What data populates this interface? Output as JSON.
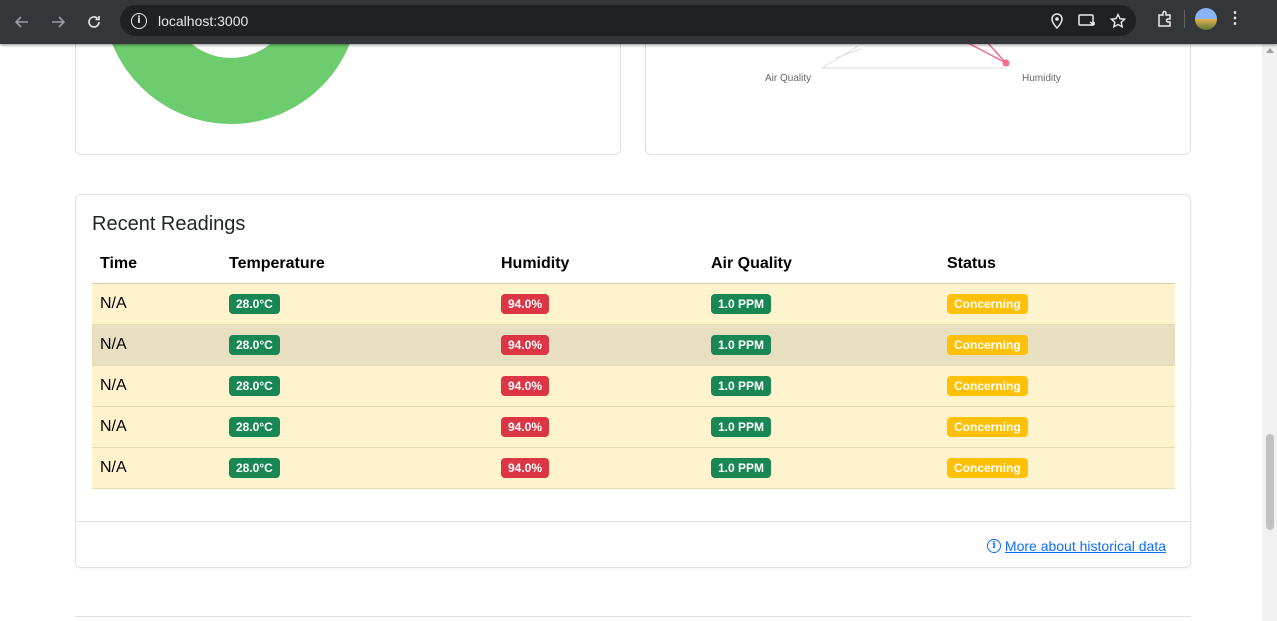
{
  "browser": {
    "url": "localhost:3000"
  },
  "radar": {
    "labels": [
      "Air Quality",
      "Humidity"
    ]
  },
  "readings": {
    "title": "Recent Readings",
    "columns": [
      "Time",
      "Temperature",
      "Humidity",
      "Air Quality",
      "Status"
    ],
    "rows": [
      {
        "time": "N/A",
        "temperature": "28.0°C",
        "humidity": "94.0%",
        "air_quality": "1.0 PPM",
        "status": "Concerning"
      },
      {
        "time": "N/A",
        "temperature": "28.0°C",
        "humidity": "94.0%",
        "air_quality": "1.0 PPM",
        "status": "Concerning"
      },
      {
        "time": "N/A",
        "temperature": "28.0°C",
        "humidity": "94.0%",
        "air_quality": "1.0 PPM",
        "status": "Concerning"
      },
      {
        "time": "N/A",
        "temperature": "28.0°C",
        "humidity": "94.0%",
        "air_quality": "1.0 PPM",
        "status": "Concerning"
      },
      {
        "time": "N/A",
        "temperature": "28.0°C",
        "humidity": "94.0%",
        "air_quality": "1.0 PPM",
        "status": "Concerning"
      }
    ],
    "footer_link": "More about historical data"
  },
  "colors": {
    "good": "#198754",
    "danger": "#dc3545",
    "warning": "#ffc107",
    "row_warning": "#fff3cd",
    "donut": "#6dcc6d",
    "radar_point": "#f06b8c"
  }
}
